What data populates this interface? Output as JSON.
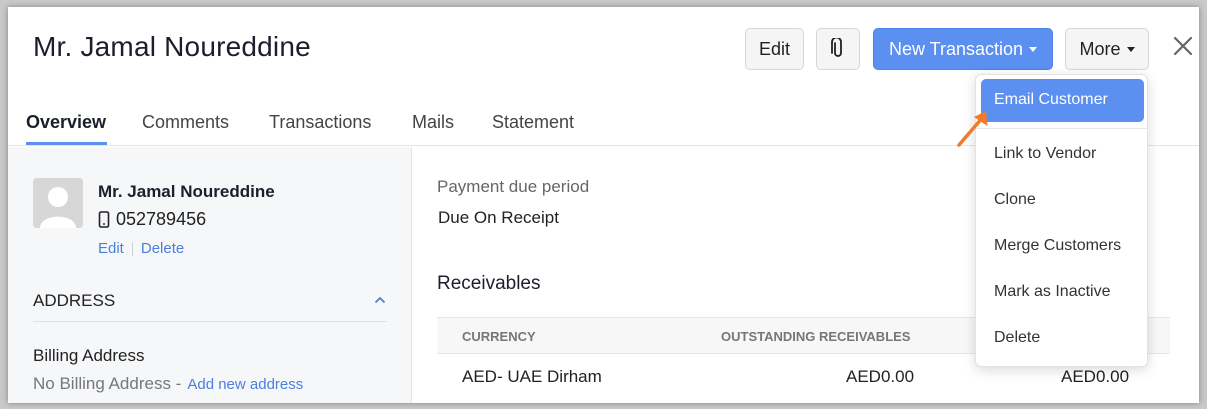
{
  "customer": {
    "title": "Mr. Jamal Noureddine",
    "phone": "052789456",
    "edit_link": "Edit",
    "delete_link": "Delete"
  },
  "toolbar": {
    "edit_label": "Edit",
    "new_transaction_label": "New Transaction",
    "more_label": "More"
  },
  "tabs": [
    "Overview",
    "Comments",
    "Transactions",
    "Mails",
    "Statement"
  ],
  "address": {
    "heading": "ADDRESS",
    "billing_label": "Billing Address",
    "no_billing": "No Billing Address -",
    "add_new": "Add new address"
  },
  "details": {
    "payment_due_label": "Payment due period",
    "payment_due_value": "Due On Receipt",
    "receivables_heading": "Receivables",
    "columns": [
      "CURRENCY",
      "OUTSTANDING RECEIVABLES"
    ],
    "rows": [
      {
        "currency": "AED- UAE Dirham",
        "outstanding": "AED0.00",
        "extra": "AED0.00"
      }
    ]
  },
  "more_menu": {
    "items": [
      "Email Customer",
      "Link to Vendor",
      "Clone",
      "Merge Customers",
      "Mark as Inactive",
      "Delete"
    ]
  },
  "colors": {
    "accent": "#5b8ff0",
    "link": "#4a7fe0",
    "annotation_arrow": "#f07b2a"
  },
  "icons": [
    "paperclip-icon",
    "close-icon",
    "avatar-icon",
    "mobile-phone-icon",
    "chevron-up-icon",
    "caret-down-icon"
  ]
}
